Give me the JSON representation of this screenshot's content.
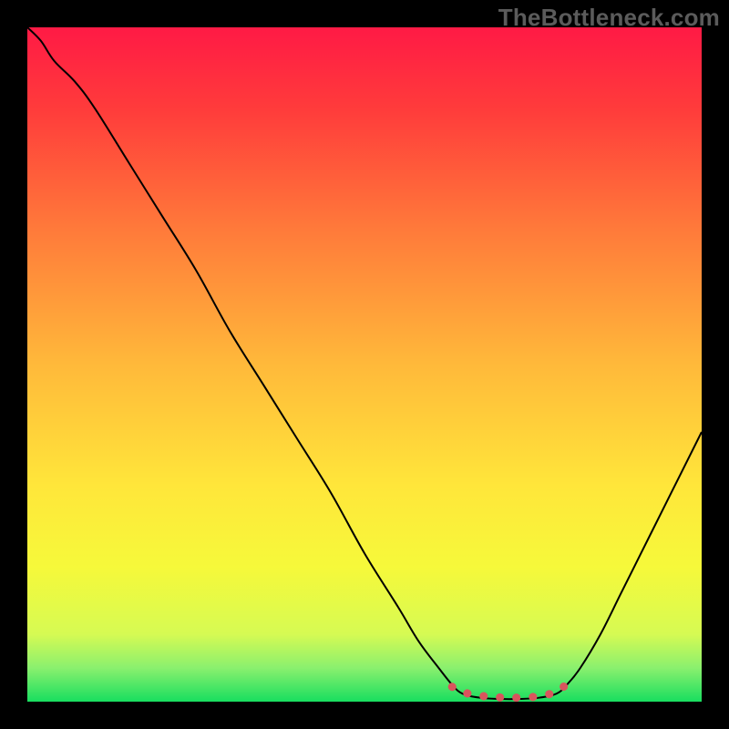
{
  "watermark": "TheBottleneck.com",
  "chart_data": {
    "type": "line",
    "title": "",
    "xlabel": "",
    "ylabel": "",
    "xlim": [
      0,
      100
    ],
    "ylim": [
      0,
      100
    ],
    "grid": false,
    "legend": false,
    "gradient_stops": [
      {
        "offset": 0,
        "color": "#ff1a45"
      },
      {
        "offset": 0.12,
        "color": "#ff3b3b"
      },
      {
        "offset": 0.3,
        "color": "#ff7a3a"
      },
      {
        "offset": 0.5,
        "color": "#ffb93a"
      },
      {
        "offset": 0.68,
        "color": "#ffe63a"
      },
      {
        "offset": 0.8,
        "color": "#f6f93a"
      },
      {
        "offset": 0.9,
        "color": "#d6fa53"
      },
      {
        "offset": 0.95,
        "color": "#8af06e"
      },
      {
        "offset": 1.0,
        "color": "#18de5f"
      }
    ],
    "series": [
      {
        "name": "bottleneck-curve",
        "stroke": "#000000",
        "stroke_width": 2,
        "points": [
          {
            "x": 0,
            "y": 100
          },
          {
            "x": 2,
            "y": 98
          },
          {
            "x": 4,
            "y": 95
          },
          {
            "x": 7,
            "y": 92
          },
          {
            "x": 10,
            "y": 88
          },
          {
            "x": 15,
            "y": 80
          },
          {
            "x": 20,
            "y": 72
          },
          {
            "x": 25,
            "y": 64
          },
          {
            "x": 30,
            "y": 55
          },
          {
            "x": 35,
            "y": 47
          },
          {
            "x": 40,
            "y": 39
          },
          {
            "x": 45,
            "y": 31
          },
          {
            "x": 50,
            "y": 22
          },
          {
            "x": 55,
            "y": 14
          },
          {
            "x": 58,
            "y": 9
          },
          {
            "x": 61,
            "y": 5
          },
          {
            "x": 63,
            "y": 2.5
          },
          {
            "x": 64.5,
            "y": 1.2
          },
          {
            "x": 67,
            "y": 0.6
          },
          {
            "x": 70,
            "y": 0.4
          },
          {
            "x": 73,
            "y": 0.4
          },
          {
            "x": 76,
            "y": 0.6
          },
          {
            "x": 78.5,
            "y": 1.2
          },
          {
            "x": 80,
            "y": 2.5
          },
          {
            "x": 82,
            "y": 5
          },
          {
            "x": 85,
            "y": 10
          },
          {
            "x": 88,
            "y": 16
          },
          {
            "x": 91,
            "y": 22
          },
          {
            "x": 94,
            "y": 28
          },
          {
            "x": 97,
            "y": 34
          },
          {
            "x": 100,
            "y": 40
          }
        ]
      },
      {
        "name": "optimal-zone-marker",
        "stroke": "#d9555d",
        "stroke_width": 9,
        "linecap": "round",
        "dash": "0.1 18",
        "points": [
          {
            "x": 63,
            "y": 2.2
          },
          {
            "x": 65,
            "y": 1.3
          },
          {
            "x": 67,
            "y": 0.9
          },
          {
            "x": 69,
            "y": 0.7
          },
          {
            "x": 71,
            "y": 0.6
          },
          {
            "x": 73,
            "y": 0.6
          },
          {
            "x": 75,
            "y": 0.7
          },
          {
            "x": 77,
            "y": 1.0
          },
          {
            "x": 79,
            "y": 1.8
          },
          {
            "x": 80.5,
            "y": 3.2
          }
        ]
      }
    ]
  }
}
